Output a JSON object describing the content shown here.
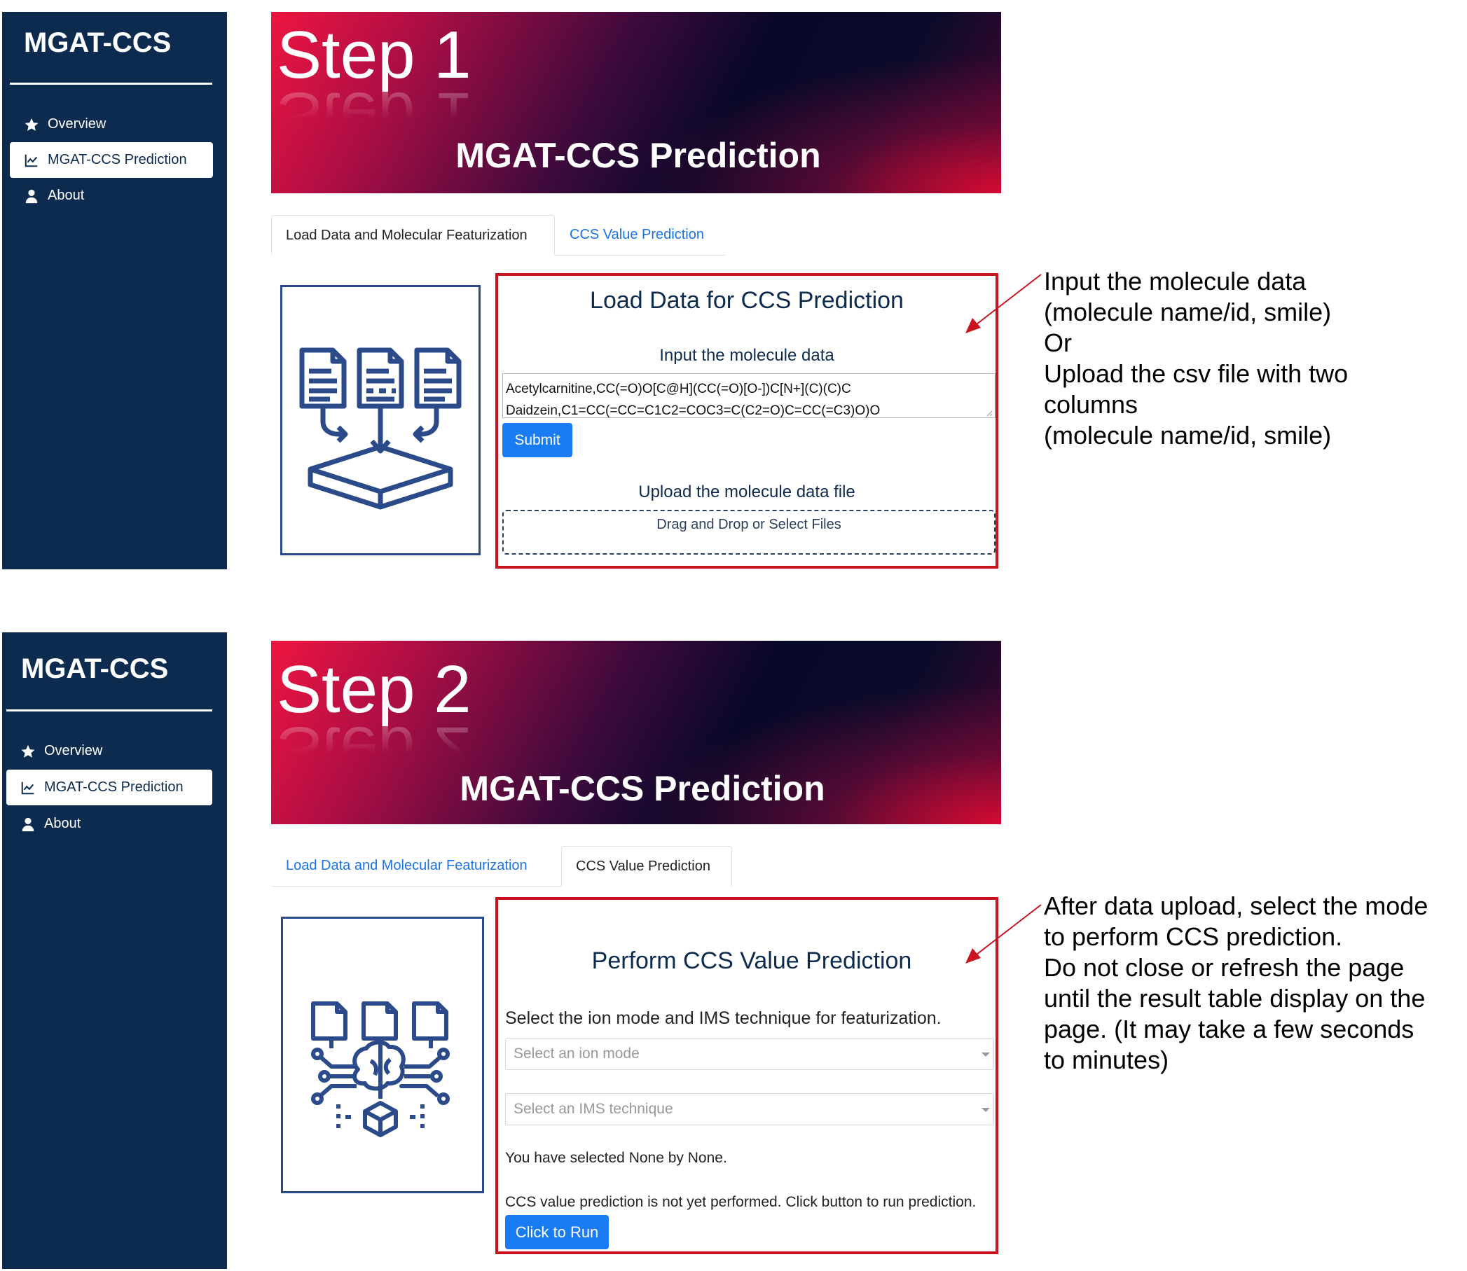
{
  "step1": {
    "app_title": "MGAT-CCS",
    "nav": [
      {
        "label": "Overview",
        "icon": "star-icon"
      },
      {
        "label": "MGAT-CCS Prediction",
        "icon": "line-chart-icon"
      },
      {
        "label": "About",
        "icon": "user-icon"
      }
    ],
    "banner": {
      "step": "Step 1",
      "title": "MGAT-CCS Prediction"
    },
    "tabs": [
      "Load Data and Molecular Featurization",
      "CCS Value Prediction"
    ],
    "active_tab": "Load Data and Molecular Featurization",
    "panel": {
      "heading": "Load Data for CCS Prediction",
      "input_label": "Input the molecule data",
      "input_value": "Acetylcarnitine,CC(=O)O[C@H](CC(=O)[O-])C[N+](C)(C)C\nDaidzein,C1=CC(=CC=C1C2=COC3=C(C2=O)C=CC(=C3)O)O",
      "submit_label": "Submit",
      "upload_label": "Upload the molecule data file",
      "dropzone_text": "Drag and Drop or Select Files"
    },
    "note_lines": [
      "Input the molecule data",
      "(molecule name/id, smile)",
      "Or",
      "Upload the csv file with two",
      "columns",
      "(molecule name/id, smile)"
    ]
  },
  "step2": {
    "app_title": "MGAT-CCS",
    "nav": [
      {
        "label": "Overview",
        "icon": "star-icon"
      },
      {
        "label": "MGAT-CCS Prediction",
        "icon": "line-chart-icon"
      },
      {
        "label": "About",
        "icon": "user-icon"
      }
    ],
    "banner": {
      "step": "Step 2",
      "title": "MGAT-CCS Prediction"
    },
    "tabs": [
      "Load Data and Molecular Featurization",
      "CCS Value Prediction"
    ],
    "active_tab": "CCS Value Prediction",
    "panel": {
      "heading": "Perform CCS Value Prediction",
      "select_label": "Select the ion mode and IMS technique for featurization.",
      "ion_mode_placeholder": "Select an ion mode",
      "ims_placeholder": "Select an IMS technique",
      "selection_text": "You have selected None by None.",
      "status_text": "CCS value prediction is not yet performed. Click button to run prediction.",
      "run_label": "Click to Run"
    },
    "note_lines": [
      "After data upload, select the mode",
      "to perform CCS prediction.",
      "Do not close or refresh the page",
      "until the result table display on the",
      "page. (It may take a few seconds",
      "to minutes)"
    ]
  },
  "colors": {
    "sidebar_bg": "#0d2b4e",
    "accent_blue": "#1a7cf2",
    "highlight_red": "#c8141e",
    "link_blue": "#1a73e8"
  }
}
